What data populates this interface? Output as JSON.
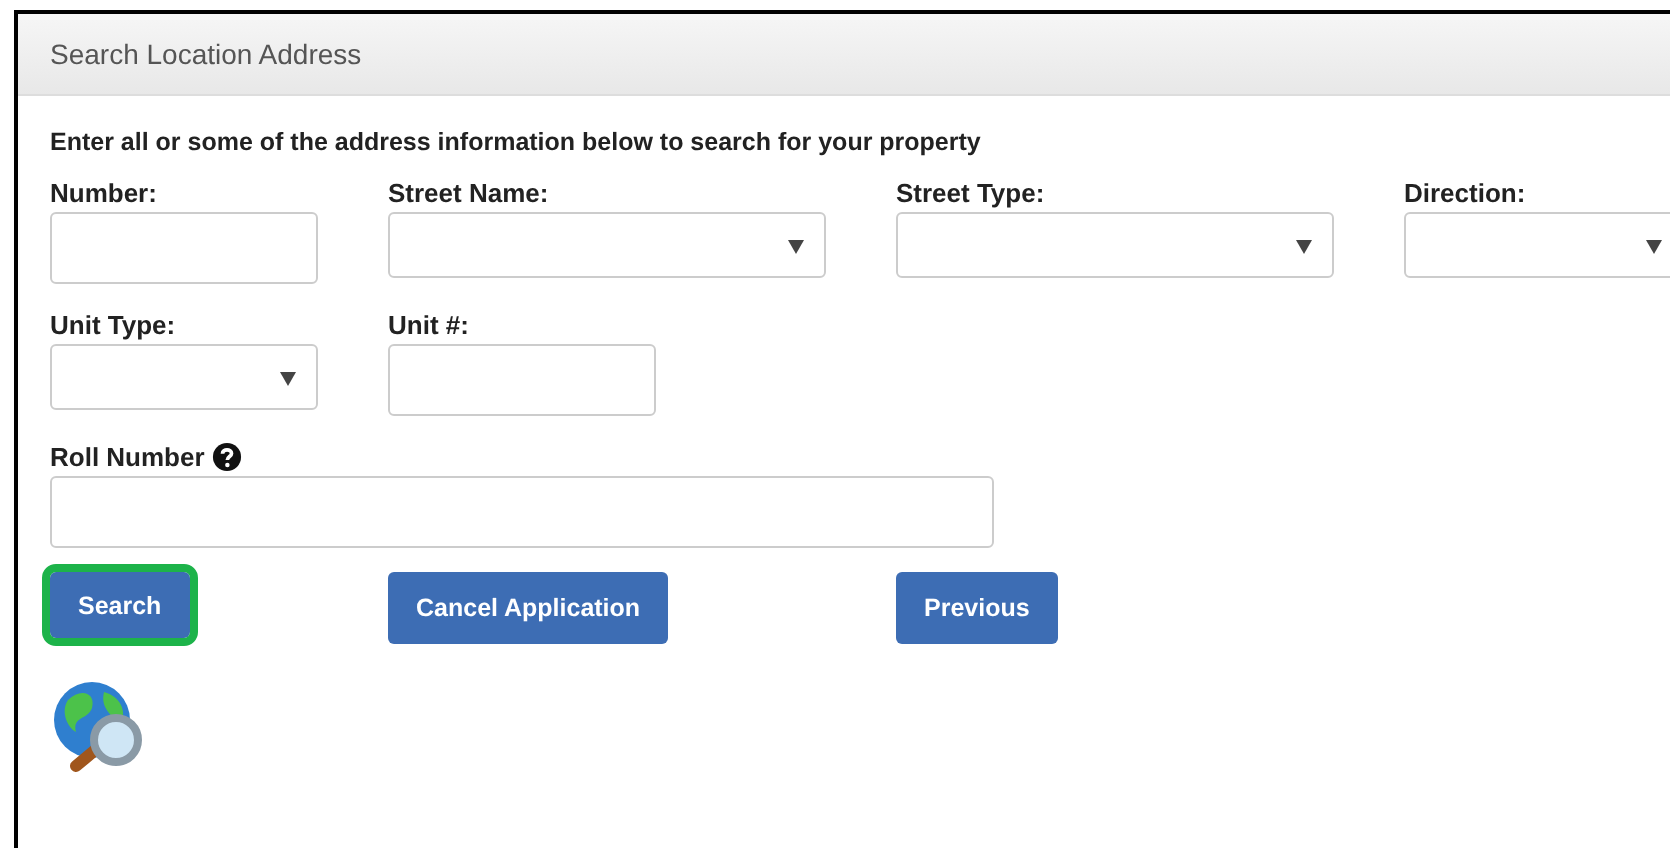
{
  "panel": {
    "title": "Search Location Address"
  },
  "instructions": "Enter all or some of the address information below to search for your property",
  "field_rows": [
    [
      {
        "label": "Number:",
        "kind": "text",
        "help": false
      },
      {
        "label": "Street Name:",
        "kind": "select",
        "help": false
      },
      {
        "label": "Street Type:",
        "kind": "select",
        "help": false
      },
      {
        "label": "Direction:",
        "kind": "select",
        "help": false
      }
    ],
    [
      {
        "label": "Unit Type:",
        "kind": "select",
        "help": false
      },
      {
        "label": "Unit #:",
        "kind": "text",
        "help": false
      }
    ],
    [
      {
        "label": "Roll Number",
        "kind": "text",
        "help": true
      }
    ]
  ],
  "buttons": [
    {
      "label": "Search",
      "highlighted": true
    },
    {
      "label": "Cancel Application",
      "highlighted": false
    },
    {
      "label": "Previous",
      "highlighted": false
    }
  ]
}
